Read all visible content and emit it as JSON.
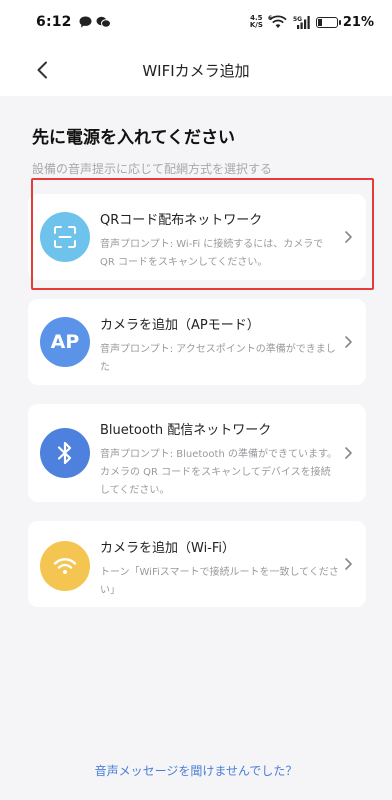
{
  "status_bar": {
    "time": "6:12",
    "net_speed_top": "4.5",
    "net_speed_bottom": "K/S",
    "wifi_tag": "6",
    "signal_tag": "5G",
    "battery": "21%"
  },
  "nav": {
    "title": "WIFIカメラ追加"
  },
  "main": {
    "heading": "先に電源を入れてください",
    "subheading": "設備の音声提示に応じて配網方式を選択する",
    "options": [
      {
        "title": "QRコード配布ネットワーク",
        "desc": "音声プロンプト: Wi-Fi に接続するには、カメラで QR コードをスキャンしてください。",
        "icon": "qr-scan-icon",
        "color": "#6ec3ec"
      },
      {
        "title": "カメラを追加（APモード）",
        "desc": "音声プロンプト: アクセスポイントの準備ができました",
        "icon_text": "AP",
        "color": "#5b93e9"
      },
      {
        "title": "Bluetooth 配信ネットワーク",
        "desc": "音声プロンプト: Bluetooth の準備ができています。 カメラの QR コードをスキャンしてデバイスを接続してください。",
        "icon": "bluetooth-icon",
        "color": "#4e81dd"
      },
      {
        "title": "カメラを追加（Wi-Fi）",
        "desc": "トーン「WiFiスマートで接続ルートを一致してください」",
        "icon": "wifi-icon",
        "color": "#f4c550"
      }
    ],
    "footer_link": "音声メッセージを聞けませんでした？"
  },
  "colors": {
    "highlight": "#e63b3b",
    "link": "#4a7fd6"
  }
}
